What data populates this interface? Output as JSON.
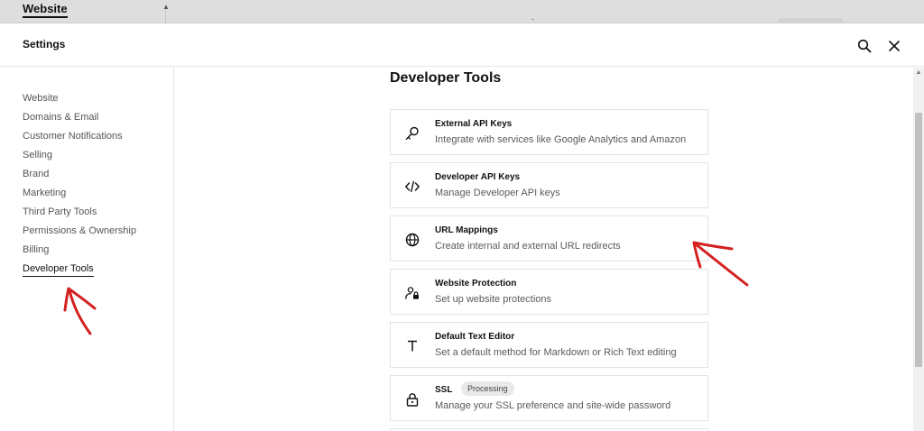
{
  "backdrop": {
    "site_title": "Website"
  },
  "header": {
    "title": "Settings"
  },
  "sidebar": {
    "items": [
      {
        "label": "Website"
      },
      {
        "label": "Domains & Email"
      },
      {
        "label": "Customer Notifications"
      },
      {
        "label": "Selling"
      },
      {
        "label": "Brand"
      },
      {
        "label": "Marketing"
      },
      {
        "label": "Third Party Tools"
      },
      {
        "label": "Permissions & Ownership"
      },
      {
        "label": "Billing"
      },
      {
        "label": "Developer Tools"
      }
    ],
    "active": "Developer Tools"
  },
  "main": {
    "title": "Developer Tools",
    "cards": [
      {
        "icon": "key-icon",
        "title": "External API Keys",
        "desc": "Integrate with services like Google Analytics and Amazon"
      },
      {
        "icon": "code-icon",
        "title": "Developer API Keys",
        "desc": "Manage Developer API keys"
      },
      {
        "icon": "globe-icon",
        "title": "URL Mappings",
        "desc": "Create internal and external URL redirects"
      },
      {
        "icon": "user-lock-icon",
        "title": "Website Protection",
        "desc": "Set up website protections"
      },
      {
        "icon": "text-icon",
        "title": "Default Text Editor",
        "desc": "Set a default method for Markdown or Rich Text editing"
      },
      {
        "icon": "lock-icon",
        "title": "SSL",
        "badge": "Processing",
        "desc": "Manage your SSL preference and site-wide password"
      }
    ]
  },
  "colors": {
    "annotation": "#d42020",
    "text": "#111111",
    "muted": "#5a5a5a",
    "border": "#e3e3e3"
  }
}
